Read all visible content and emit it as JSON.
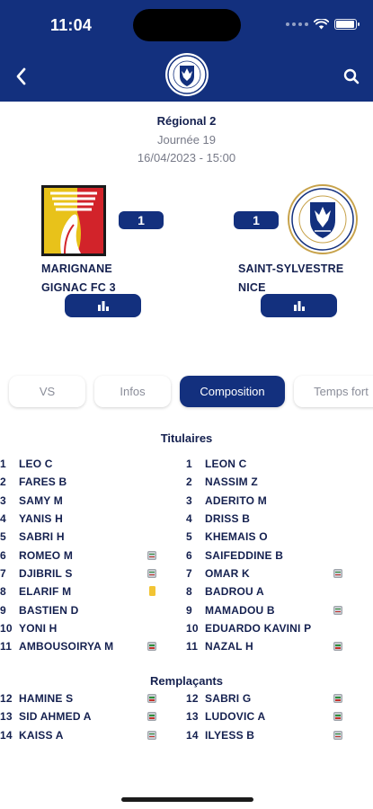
{
  "status_bar": {
    "time": "11:04",
    "battery_level": 0.95
  },
  "header": {
    "back_icon": "chevron-left-icon",
    "search_icon": "search-icon",
    "club_logo": "club-crest-icon"
  },
  "match": {
    "competition": "Régional 2",
    "matchday": "Journée 19",
    "datetime": "16/04/2023 - 15:00",
    "home": {
      "name_line1": "MARIGNANE",
      "name_line2": "GIGNAC FC 3",
      "score": "1"
    },
    "away": {
      "name_line1": "SAINT-SYLVESTRE",
      "name_line2": "NICE",
      "score": "1"
    }
  },
  "tabs": [
    {
      "id": "vs",
      "label": "VS",
      "active": false
    },
    {
      "id": "infos",
      "label": "Infos",
      "active": false
    },
    {
      "id": "composition",
      "label": "Composition",
      "active": true
    },
    {
      "id": "temps",
      "label": "Temps fort",
      "active": false
    }
  ],
  "starters": {
    "title": "Titulaires",
    "home": [
      {
        "num": "1",
        "name": "LEO C",
        "icon": ""
      },
      {
        "num": "2",
        "name": "FARES B",
        "icon": ""
      },
      {
        "num": "3",
        "name": "SAMY M",
        "icon": ""
      },
      {
        "num": "4",
        "name": "YANIS H",
        "icon": ""
      },
      {
        "num": "5",
        "name": "SABRI H",
        "icon": ""
      },
      {
        "num": "6",
        "name": "ROMEO M",
        "icon": "substitution"
      },
      {
        "num": "7",
        "name": "DJIBRIL S",
        "icon": "substitution"
      },
      {
        "num": "8",
        "name": "ELARIF M",
        "icon": "yellow-card"
      },
      {
        "num": "9",
        "name": "BASTIEN D",
        "icon": ""
      },
      {
        "num": "10",
        "name": "YONI H",
        "icon": ""
      },
      {
        "num": "11",
        "name": "AMBOUSOIRYA M",
        "icon": "substitution"
      }
    ],
    "away": [
      {
        "num": "1",
        "name": "LEON C",
        "icon": ""
      },
      {
        "num": "2",
        "name": "NASSIM Z",
        "icon": ""
      },
      {
        "num": "3",
        "name": "ADERITO M",
        "icon": ""
      },
      {
        "num": "4",
        "name": "DRISS B",
        "icon": ""
      },
      {
        "num": "5",
        "name": "KHEMAIS O",
        "icon": ""
      },
      {
        "num": "6",
        "name": "SAIFEDDINE B",
        "icon": ""
      },
      {
        "num": "7",
        "name": "OMAR K",
        "icon": "substitution"
      },
      {
        "num": "8",
        "name": "BADROU A",
        "icon": ""
      },
      {
        "num": "9",
        "name": "MAMADOU B",
        "icon": "substitution"
      },
      {
        "num": "10",
        "name": "EDUARDO KAVINI P",
        "icon": ""
      },
      {
        "num": "11",
        "name": "NAZAL H",
        "icon": "substitution"
      }
    ]
  },
  "substitutes": {
    "title": "Remplaçants",
    "home": [
      {
        "num": "12",
        "name": "HAMINE S",
        "icon": "substitution"
      },
      {
        "num": "13",
        "name": "SID AHMED A",
        "icon": "substitution"
      },
      {
        "num": "14",
        "name": "KAISS A",
        "icon": "substitution"
      }
    ],
    "away": [
      {
        "num": "12",
        "name": "SABRI G",
        "icon": "substitution"
      },
      {
        "num": "13",
        "name": "LUDOVIC A",
        "icon": "substitution"
      },
      {
        "num": "14",
        "name": "ILYESS B",
        "icon": "substitution"
      }
    ]
  },
  "colors": {
    "primary": "#13307e",
    "text": "#14204f",
    "muted": "#777a88",
    "yellow_card": "#f2c434"
  }
}
